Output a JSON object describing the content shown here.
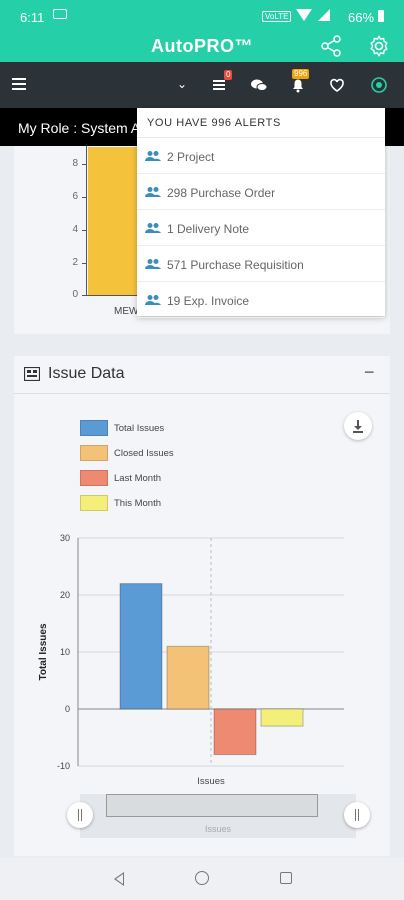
{
  "status_bar": {
    "time": "6:11",
    "network_label": "VoLTE",
    "battery": "66%"
  },
  "app": {
    "title": "AutoPRO™"
  },
  "navbar": {
    "chevron": "⌄",
    "cart_badge": "0",
    "alerts_badge": "996"
  },
  "role": {
    "text": "My Role : System Ad"
  },
  "alerts": {
    "header": "YOU HAVE 996 ALERTS",
    "items": [
      {
        "label": "2 Project"
      },
      {
        "label": "298 Purchase Order"
      },
      {
        "label": "1 Delivery Note"
      },
      {
        "label": "571 Purchase Requisition"
      },
      {
        "label": "19 Exp. Invoice"
      }
    ]
  },
  "top_chart": {
    "y_ticks": [
      "8",
      "6",
      "4",
      "2",
      "0"
    ],
    "bar_value": 9,
    "category": "MEW"
  },
  "issue_card": {
    "title": "Issue Data",
    "collapse": "−",
    "slider_label": "Issues"
  },
  "chart_data": {
    "type": "bar",
    "title": "",
    "xlabel": "Issues",
    "ylabel": "Total Issues",
    "categories": [
      "Issues"
    ],
    "ylim": [
      -10,
      30
    ],
    "y_ticks": [
      30,
      20,
      10,
      0,
      -10
    ],
    "grid": true,
    "legend_position": "top-left",
    "series": [
      {
        "name": "Total Issues",
        "values": [
          22
        ],
        "color": "#5b9bd5"
      },
      {
        "name": "Closed Issues",
        "values": [
          11
        ],
        "color": "#f3c277"
      },
      {
        "name": "Last Month",
        "values": [
          -8
        ],
        "color": "#ef8a72"
      },
      {
        "name": "This Month",
        "values": [
          -3
        ],
        "color": "#f4ee7a"
      }
    ]
  },
  "colors": {
    "teal": "#25d0a9",
    "nav_dark": "#2b3238",
    "accent_yellow": "#f5c23b"
  }
}
